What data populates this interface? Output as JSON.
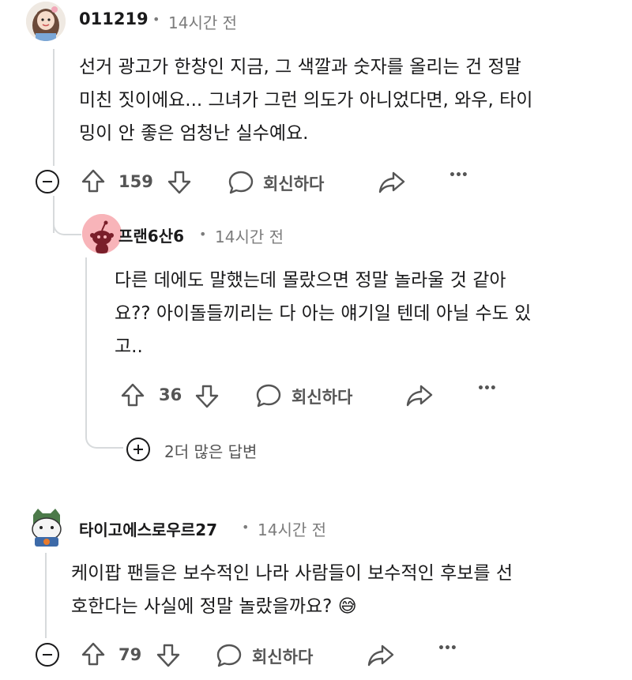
{
  "comments": [
    {
      "username": "011219",
      "time": "14시간 전",
      "body_lines": [
        "선거 광고가 한창인 지금, 그 색깔과 숫자를 올리는 건 정말",
        "미친 짓이에요... 그녀가 그런 의도가 아니었다면, 와우, 타이",
        "밍이 안 좋은 엄청난 실수예요."
      ],
      "votes": "159",
      "reply_label": "회신하다"
    },
    {
      "username": "프랜6산6",
      "time": "14시간 전",
      "body_lines": [
        "다른 데에도 말했는데 몰랐으면 정말 놀라울 것 같아",
        "요?? 아이돌들끼리는 다 아는 얘기일 텐데 아닐 수도 있",
        "고.."
      ],
      "votes": "36",
      "reply_label": "회신하다",
      "more_replies": "2더 많은 답변"
    },
    {
      "username": "타이고에스로우르27",
      "time": "14시간 전",
      "body_lines": [
        "케이팝 팬들은 보수적인 나라 사람들이 보수적인 후보를 선",
        "호한다는 사실에 정말 놀랐을까요? 😅"
      ],
      "votes": "79",
      "reply_label": "회신하다"
    }
  ],
  "separator": "•",
  "more_glyph": "•••",
  "colors": {
    "text": "#1a1a1b",
    "muted": "#7c7c7c",
    "action": "#555555",
    "thread_line": "#d7dadc",
    "snoo_bg": "#f8b4b9"
  }
}
